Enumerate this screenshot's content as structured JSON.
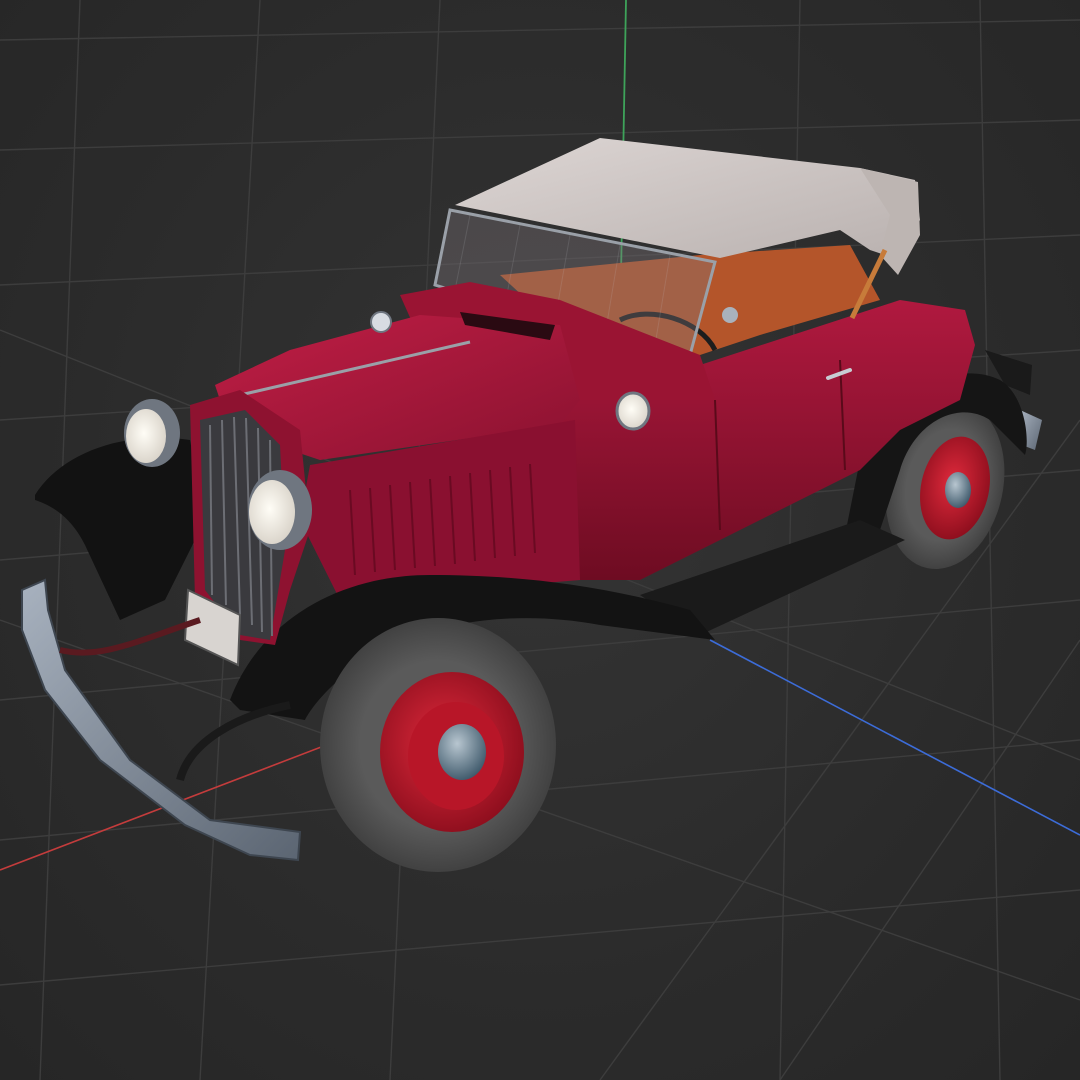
{
  "viewport": {
    "background_color": "#2b2b2b",
    "grid_color": "#3d3d3d",
    "axis_colors": {
      "x": "#c43c3c",
      "y": "#3ea35a",
      "z": "#3c6cd8"
    }
  },
  "model": {
    "body_color": "#8e1230",
    "fender_color": "#141414",
    "roof_color": "#cfc8c6",
    "interior_color": "#b4552a",
    "wheel_hub_color": "#cc1a2c",
    "tire_color": "#4a4a4a",
    "chrome_color": "#8a96a4",
    "headlight_color": "#f1ede6"
  }
}
